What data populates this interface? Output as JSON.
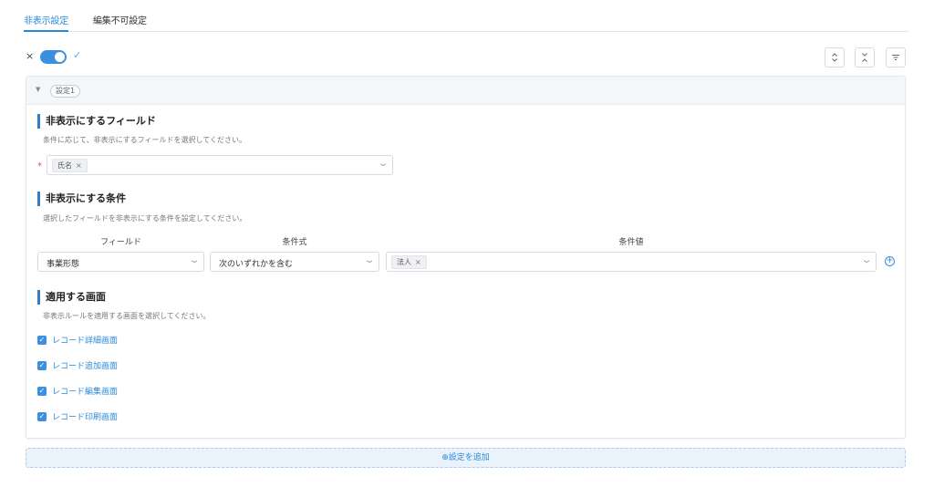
{
  "tabs": [
    {
      "label": "非表示設定",
      "active": true
    },
    {
      "label": "編集不可設定",
      "active": false
    }
  ],
  "toolbar": {
    "off_mark": "×",
    "on_mark": "✓",
    "toggle_on": true,
    "icons": [
      "expand-collapse-icon",
      "collapse-all-icon",
      "sort-icon"
    ]
  },
  "rule": {
    "tag": "設定1",
    "hidden_fields": {
      "title": "非表示にするフィールド",
      "desc": "条件に応じて、非表示にするフィールドを選択してください。",
      "required_mark": "*",
      "selected": [
        "氏名"
      ]
    },
    "conditions": {
      "title": "非表示にする条件",
      "desc": "選択したフィールドを非表示にする条件を設定してください。",
      "headers": {
        "field": "フィールド",
        "operator": "条件式",
        "value": "条件値"
      },
      "row": {
        "field": "事業形態",
        "operator": "次のいずれかを含む",
        "values": [
          "法人"
        ]
      }
    },
    "screens": {
      "title": "適用する画面",
      "desc": "非表示ルールを適用する画面を選択してください。",
      "options": [
        {
          "label": "レコード詳細画面",
          "checked": true
        },
        {
          "label": "レコード追加画面",
          "checked": true
        },
        {
          "label": "レコード編集画面",
          "checked": true
        },
        {
          "label": "レコード印刷画面",
          "checked": true
        }
      ]
    }
  },
  "add_setting": {
    "icon": "⊕",
    "label": "設定を追加"
  },
  "colors": {
    "accent": "#2a8ad6",
    "toggle": "#3b8fe0",
    "section_bar": "#2f7cc7",
    "required": "#e0524f"
  }
}
